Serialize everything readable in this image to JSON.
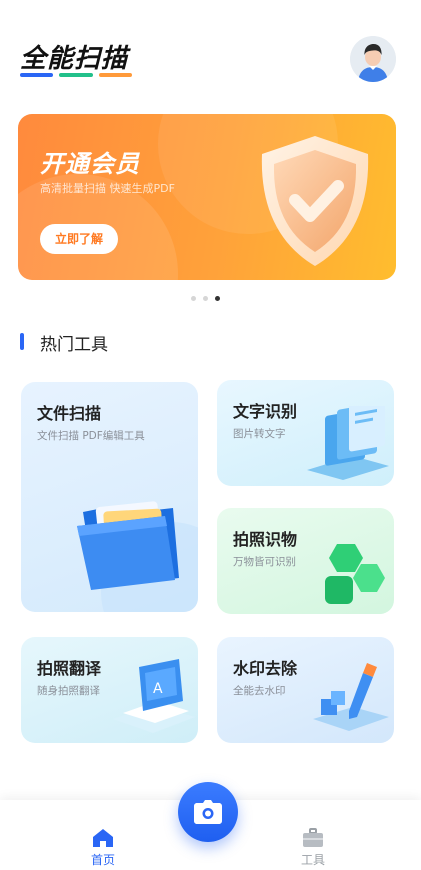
{
  "header": {
    "app_title": "全能扫描",
    "underline_colors": [
      "#2a66f5",
      "#22c08a",
      "#ff9a3a"
    ]
  },
  "banner": {
    "title": "开通会员",
    "subtitle": "高清批量扫描 快速生成PDF",
    "button_label": "立即了解",
    "pagination": {
      "count": 3,
      "active_index": 2
    }
  },
  "section": {
    "title": "热门工具"
  },
  "tools": [
    {
      "title": "文件扫描",
      "subtitle": "文件扫描 PDF编辑工具"
    },
    {
      "title": "文字识别",
      "subtitle": "图片转文字"
    },
    {
      "title": "拍照识物",
      "subtitle": "万物皆可识别"
    },
    {
      "title": "拍照翻译",
      "subtitle": "随身拍照翻译"
    },
    {
      "title": "水印去除",
      "subtitle": "全能去水印"
    }
  ],
  "bottom_nav": {
    "items": [
      {
        "label": "首页",
        "icon": "home-icon",
        "active": true
      },
      {
        "label": "工具",
        "icon": "toolbox-icon",
        "active": false
      }
    ],
    "camera_icon": "camera-icon"
  },
  "colors": {
    "accent": "#2a66f5",
    "banner_orange": "#ff8a3d",
    "nav_active": "#2a66f5",
    "nav_inactive": "#9aa0a6"
  }
}
